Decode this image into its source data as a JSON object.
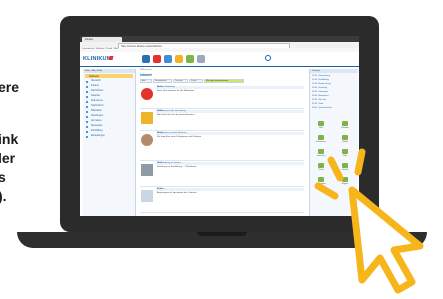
{
  "side_text": [
    "ere",
    "ink",
    "ler",
    "s",
    ")."
  ],
  "browser": {
    "tab_title": "Intranet",
    "url": "https://intranet.klinikum.de/portal/home",
    "bookmarks": "Lesezeichen · Klinikum · Portal · Mail"
  },
  "app": {
    "logo": "KLINIKUM",
    "brand_color": "#1a63a8",
    "accent_color": "#e5322d"
  },
  "left_panel": {
    "header": "Start · Mein Profil",
    "selected": "Startseite",
    "items": [
      "Übersicht",
      "Intranet",
      "Nachrichten",
      "Kalender",
      "Dokumente",
      "Telefonbuch",
      "Mitarbeiter",
      "Abteilungen",
      "Formulare",
      "Speiseplan",
      "Fortbildung",
      "Einstellungen"
    ]
  },
  "main": {
    "subtitle": "Willkommen",
    "title": "Intranet",
    "tabs": [
      "Alle",
      "Neuigkeiten",
      "Termine",
      "Portal",
      "Wichtige Informationen"
    ],
    "posts": [
      {
        "title": "Aktuelle Mitteilung",
        "date": "11.01.",
        "body": "Neue Informationen für alle Mitarbeiter"
      },
      {
        "title": "Mitteilung aus der Verwaltung",
        "date": "10.01.",
        "body": "Bitte beachten Sie die neuen Hinweise"
      },
      {
        "title": "Neuigkeiten aus dem Klinikum",
        "date": "09.01.",
        "body": "Wir begrüßen neue Kolleginnen und Kollegen"
      },
      {
        "title": "Veranstaltung im Januar",
        "date": "08.01.",
        "body": "Einladung zur Fortbildung — Weiterlesen"
      },
      {
        "title": "Hinweis",
        "date": "07.01.",
        "body": "Änderungen im Speiseplan der Cafeteria"
      }
    ]
  },
  "right_panel": {
    "header": "Termine",
    "lines": [
      "12.01. Teamsitzung",
      "13.01. Fortbildung",
      "15.01. Besprechung",
      "16.01. Schulung",
      "18.01. Dienstplan",
      "20.01. Betriebsrat",
      "22.01. Jour fixe",
      "24.01. Visite",
      "26.01. Qualitätszirkel"
    ],
    "shortcuts": [
      "Mail",
      "Kalender",
      "Dokumente",
      "Telefon",
      "Formulare",
      "Hilfe",
      "Portal",
      "Kontakt",
      "Speiseplan",
      "Support"
    ]
  }
}
